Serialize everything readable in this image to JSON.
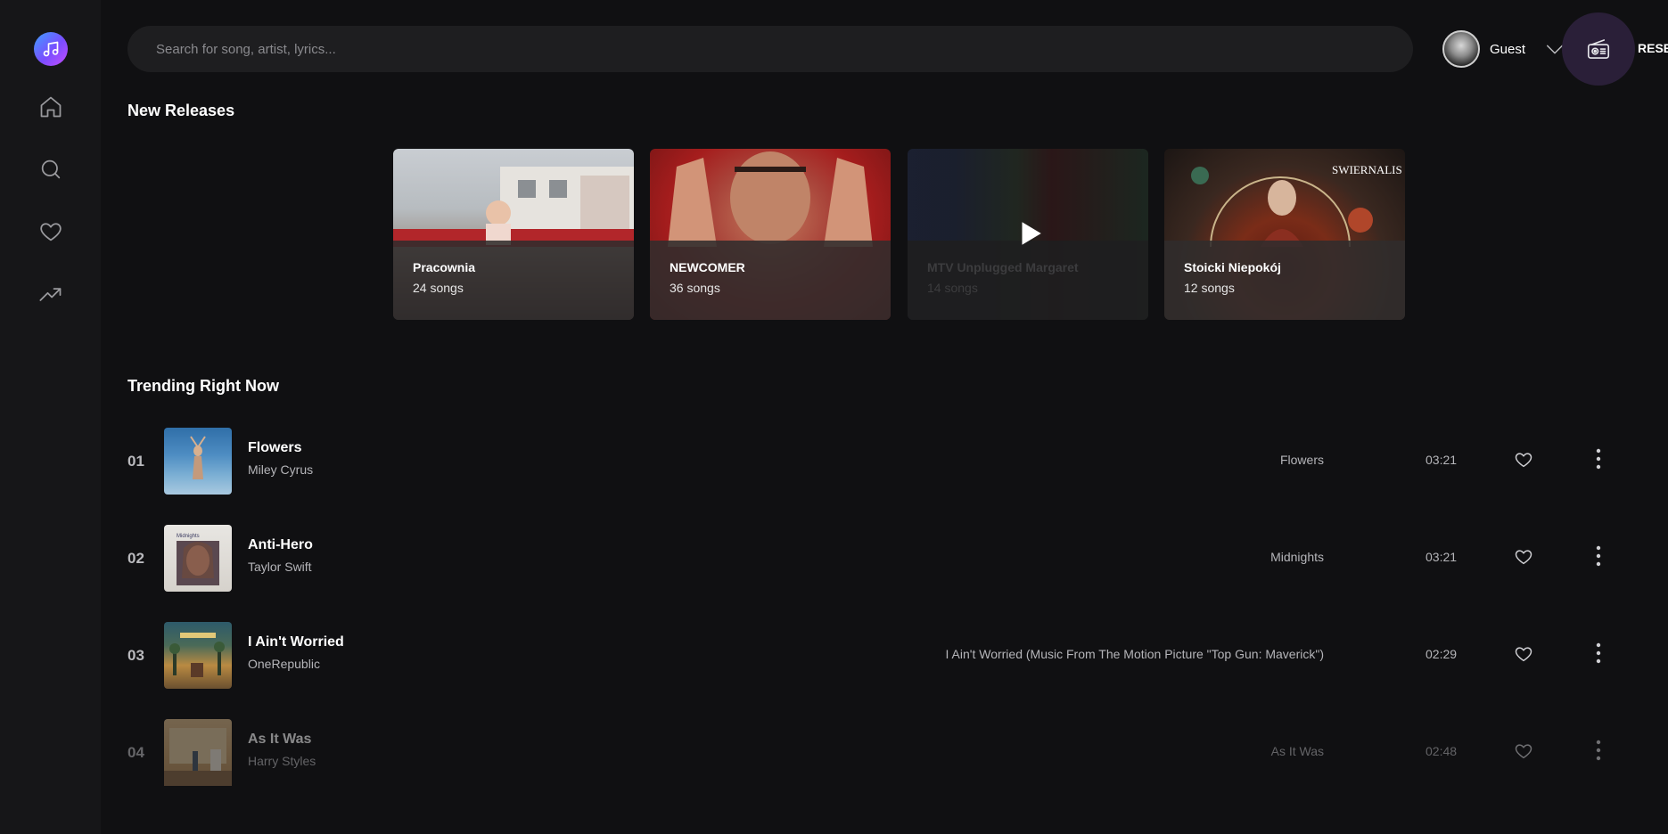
{
  "search": {
    "placeholder": "Search for song, artist, lyrics..."
  },
  "user": {
    "name": "Guest"
  },
  "radio": {
    "label": "RESE"
  },
  "sections": {
    "new_releases": "New Releases",
    "trending": "Trending Right Now"
  },
  "new_releases": [
    {
      "title": "Pracownia",
      "count": "24 songs"
    },
    {
      "title": "NEWCOMER",
      "count": "36 songs"
    },
    {
      "title": "MTV Unplugged Margaret",
      "count": "14 songs"
    },
    {
      "title": "Stoicki Niepokój",
      "count": "12 songs",
      "art_text": "SWIERNALIS"
    }
  ],
  "tracks": [
    {
      "num": "01",
      "title": "Flowers",
      "artist": "Miley Cyrus",
      "album": "Flowers",
      "duration": "03:21"
    },
    {
      "num": "02",
      "title": "Anti-Hero",
      "artist": "Taylor Swift",
      "album": "Midnights",
      "duration": "03:21",
      "art_text": "Midnights"
    },
    {
      "num": "03",
      "title": "I Ain't Worried",
      "artist": "OneRepublic",
      "album": "I Ain't Worried (Music From The Motion Picture \"Top Gun: Maverick\")",
      "duration": "02:29"
    },
    {
      "num": "04",
      "title": "As It Was",
      "artist": "Harry Styles",
      "album": "As It Was",
      "duration": "02:48"
    }
  ],
  "icons": {
    "logo": "music-note-icon",
    "nav": [
      "home-icon",
      "search-icon",
      "heart-icon",
      "trending-icon"
    ],
    "radio": "radio-icon",
    "like": "heart-outline-icon",
    "more": "vertical-dots-icon",
    "play": "play-icon"
  },
  "colors": {
    "background": "#101012",
    "sidebar": "#161618",
    "search_bg": "#1e1e20",
    "radio_bg": "#2a1f38",
    "logo_gradient_start": "#3fa0ff",
    "logo_gradient_end": "#c64dff"
  }
}
